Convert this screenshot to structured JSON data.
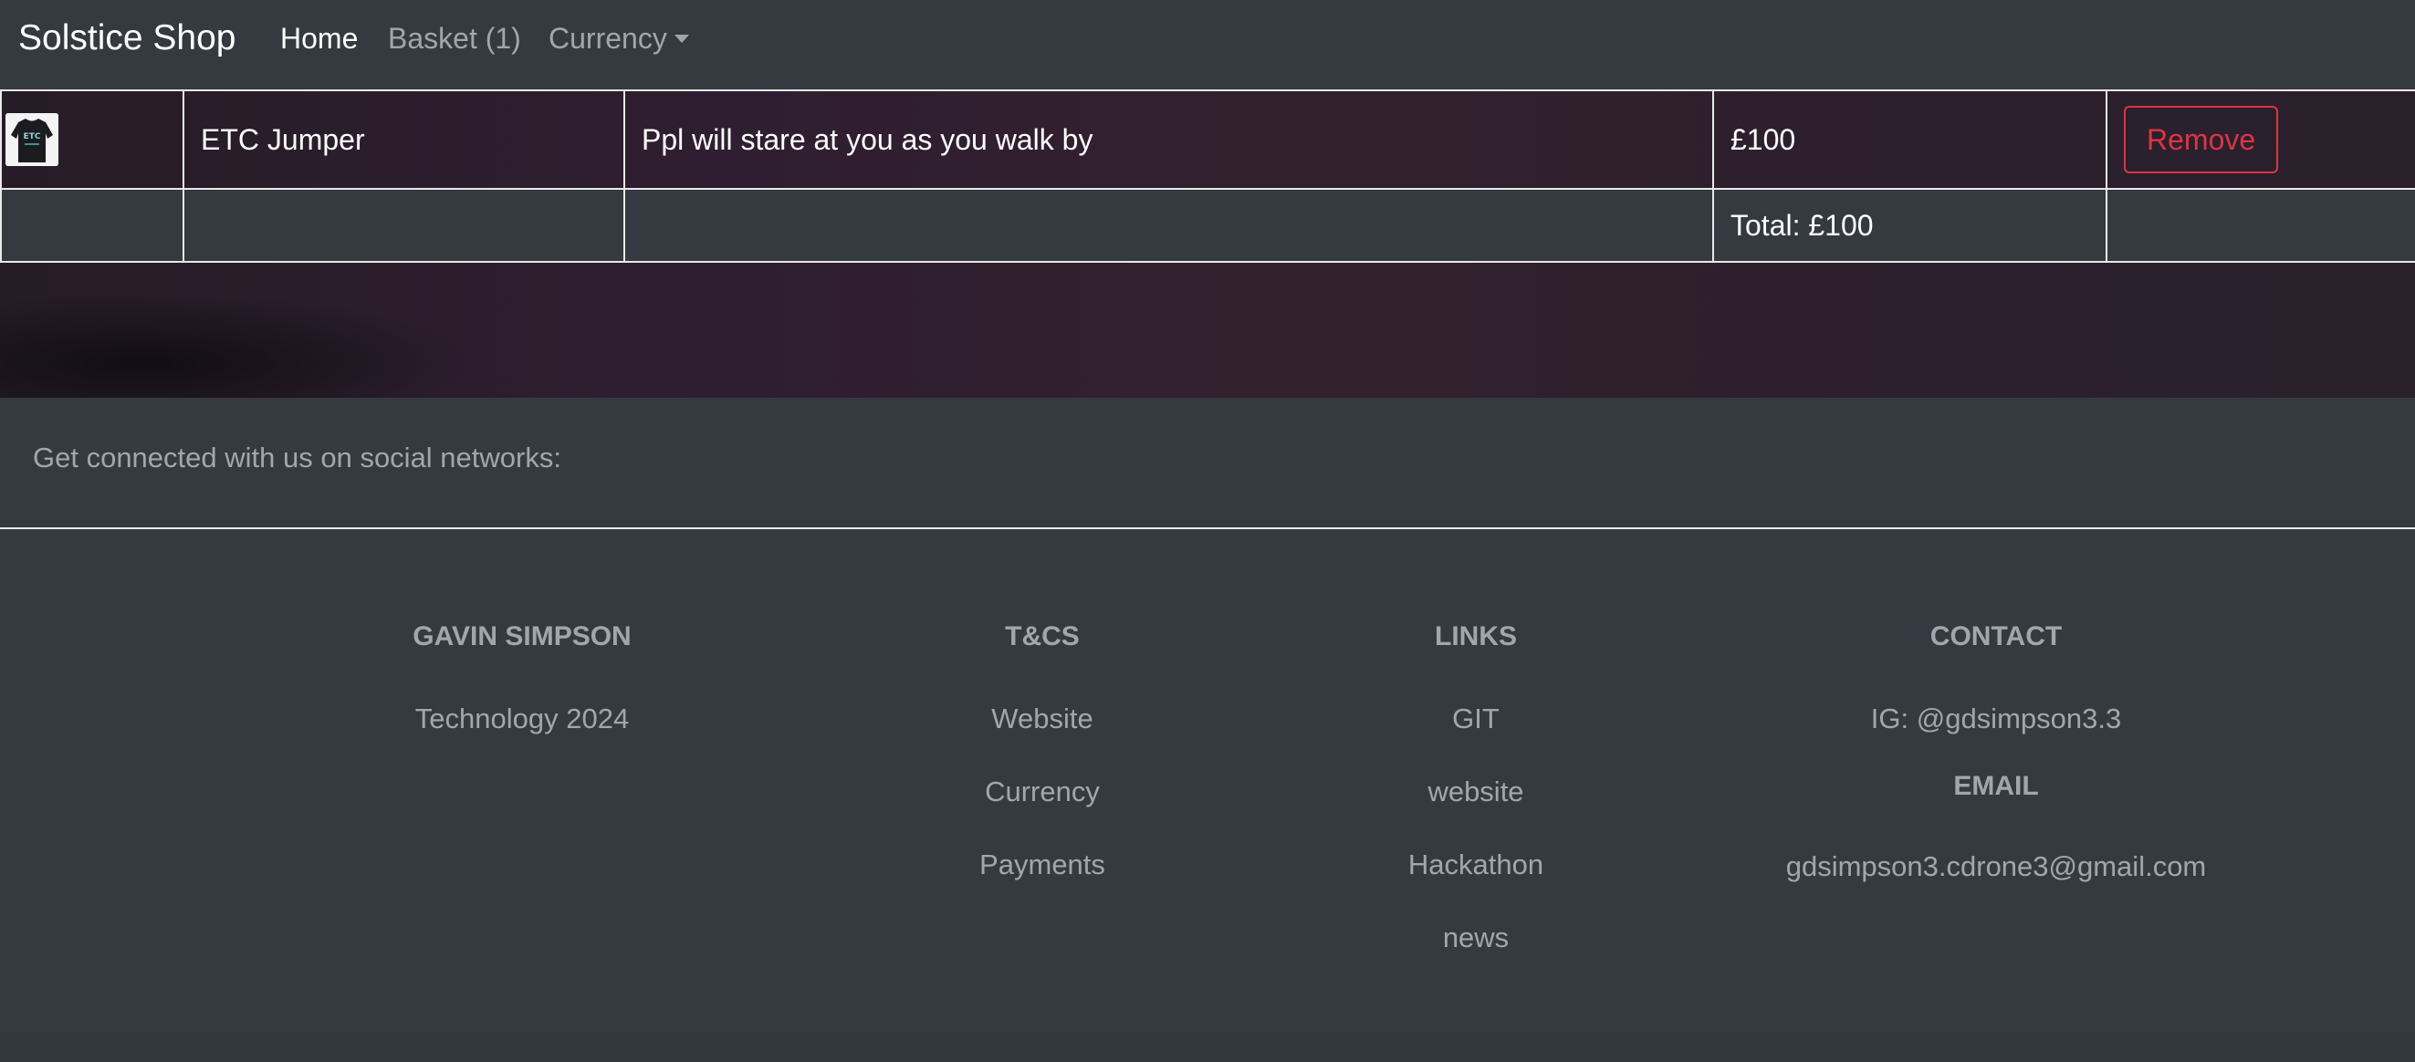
{
  "navbar": {
    "brand": "Solstice Shop",
    "home": "Home",
    "basket": "Basket (1)",
    "currency": "Currency"
  },
  "basket": {
    "items": [
      {
        "image_icon": "etc-jumper-thumbnail",
        "image_text": "ETC",
        "name": "ETC Jumper",
        "description": "Ppl will stare at you as you walk by",
        "price": "£100",
        "remove_label": "Remove"
      }
    ],
    "total": "Total: £100"
  },
  "social": {
    "text": "Get connected with us on social networks:"
  },
  "footer": {
    "about": {
      "title": "GAVIN SIMPSON",
      "text": "Technology 2024"
    },
    "tcs": {
      "title": "T&CS",
      "links": [
        "Website",
        "Currency",
        "Payments"
      ]
    },
    "links": {
      "title": "LINKS",
      "links": [
        "GIT",
        "website",
        "Hackathon",
        "news"
      ]
    },
    "contact": {
      "title": "CONTACT",
      "ig": "IG: @gdsimpson3.3",
      "email_title": "EMAIL",
      "email": "gdsimpson3.cdrone3@gmail.com"
    }
  },
  "colors": {
    "danger": "#dc3545",
    "navbar_bg": "#343a40"
  }
}
